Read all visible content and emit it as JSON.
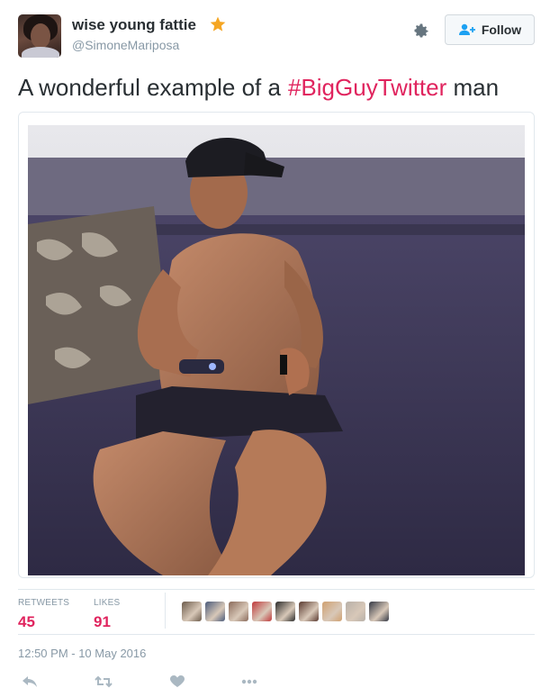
{
  "tweet": {
    "author_name": "wise young fattie",
    "author_handle": "@SimoneMariposa",
    "text_plain": "A wonderful example of a",
    "hashtag": "#BigGuyTwitter",
    "text_tail": "man",
    "follow_label": "Follow",
    "timestamp": "12:50 PM - 10 May 2016"
  },
  "stats": {
    "retweets_label": "RETWEETS",
    "retweets_value": "45",
    "likes_label": "LIKES",
    "likes_value": "91",
    "liker_avatar_colors": [
      "#6b5a4a",
      "#4a5a7a",
      "#8a6a5a",
      "#c0393b",
      "#2a2a2a",
      "#5a3a30",
      "#d0a070",
      "#b8b0a8",
      "#333844"
    ]
  },
  "actions": {
    "icons": [
      "reply-icon",
      "retweet-icon",
      "like-icon",
      "more-icon"
    ]
  },
  "colors": {
    "hashtag": "#e0245e",
    "stat_value": "#e0245e",
    "muted": "#8899a6",
    "verified_star": "#f5a623"
  }
}
